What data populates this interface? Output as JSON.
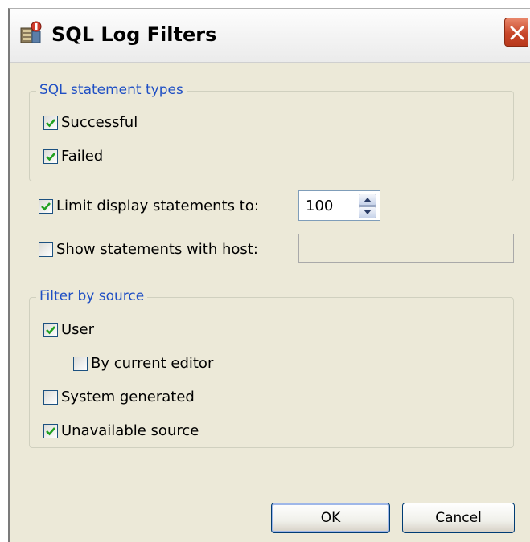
{
  "window": {
    "title": "SQL Log Filters",
    "icon": "database-filter-icon",
    "close_icon": "close-icon"
  },
  "statement_types": {
    "legend": "SQL statement types",
    "successful": {
      "label": "Successful",
      "checked": true
    },
    "failed": {
      "label": "Failed",
      "checked": true
    }
  },
  "limit": {
    "label": "Limit display statements to:",
    "checked": true,
    "value": "100"
  },
  "host": {
    "label": "Show statements with host:",
    "checked": false,
    "value": ""
  },
  "source": {
    "legend": "Filter by source",
    "user": {
      "label": "User",
      "checked": true
    },
    "current_editor": {
      "label": "By current editor",
      "checked": false
    },
    "system": {
      "label": "System generated",
      "checked": false
    },
    "unavailable": {
      "label": "Unavailable source",
      "checked": true
    }
  },
  "buttons": {
    "ok": "OK",
    "cancel": "Cancel"
  },
  "colors": {
    "legend": "#1f4fc4",
    "close": "#c8472a",
    "check": "#21a121"
  }
}
